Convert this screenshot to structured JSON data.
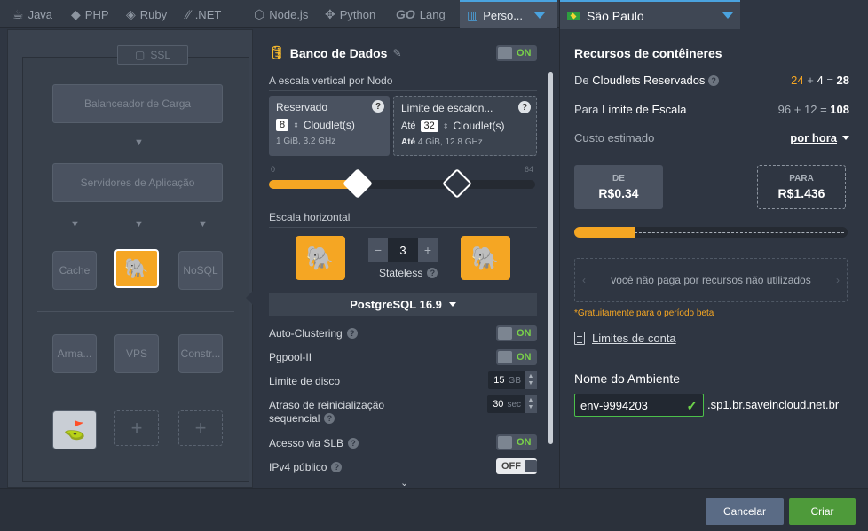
{
  "tabs": [
    {
      "label": "Java",
      "icon": "java-icon"
    },
    {
      "label": "PHP",
      "icon": "php-icon"
    },
    {
      "label": "Ruby",
      "icon": "ruby-icon"
    },
    {
      "label": ".NET",
      "icon": "dotnet-icon"
    },
    {
      "label": "Node.js",
      "icon": "nodejs-icon"
    },
    {
      "label": "Python",
      "icon": "python-icon"
    },
    {
      "label": "Lang",
      "icon": "go-icon",
      "prefix": "GO"
    },
    {
      "label": "Perso...",
      "icon": "custom-icon"
    }
  ],
  "topology": {
    "ssl_label": "SSL",
    "load_balancer": "Balanceador de Carga",
    "app_servers": "Servidores de Aplicação",
    "cache": "Cache",
    "nosql": "NoSQL",
    "storage": "Arma...",
    "vps": "VPS",
    "build": "Constr..."
  },
  "config": {
    "title": "Banco de Dados",
    "toggle_on": "ON",
    "toggle_off": "OFF",
    "vertical_scale_label": "A escala vertical por Nodo",
    "reserved": {
      "title": "Reservado",
      "count": "8",
      "unit": "Cloudlet(s)",
      "spec": "1 GiB, 3.2 GHz"
    },
    "limit": {
      "title": "Limite de escalon...",
      "prefix": "Até",
      "count": "32",
      "unit": "Cloudlet(s)",
      "spec": "4 GiB, 12.8 GHz"
    },
    "help_glyph": "?",
    "slider": {
      "min": "0",
      "max": "64",
      "reserved_value": 8,
      "limit_value": 32,
      "max_value": 64
    },
    "horizontal_scale_label": "Escala horizontal",
    "node_count": "3",
    "minus": "−",
    "plus": "+",
    "stateless_label": "Stateless",
    "version": "PostgreSQL 16.9",
    "options": {
      "auto_clustering": "Auto-Clustering",
      "pgpool": "Pgpool-II",
      "disk_limit": "Limite de disco",
      "disk_value": "15",
      "disk_unit": "GB",
      "restart_delay_1": "Atraso de reinicialização",
      "restart_delay_2": "sequencial",
      "restart_value": "30",
      "restart_unit": "sec",
      "slb_access": "Acesso via SLB",
      "public_ipv4": "IPv4 público"
    }
  },
  "summary": {
    "region": "São Paulo",
    "title": "Recursos de contêineres",
    "reserved_label_pre": "De",
    "reserved_label": "Cloudlets Reservados",
    "reserved_a": "24",
    "reserved_op": "+",
    "reserved_b": "4",
    "reserved_eq": "=",
    "reserved_total": "28",
    "limit_label_pre": "Para",
    "limit_label": "Limite de Escala",
    "limit_a": "96",
    "limit_op": "+",
    "limit_b": "12",
    "limit_eq": "=",
    "limit_total": "108",
    "estimate_label": "Custo estimado",
    "estimate_period": "por hora",
    "from_label": "DE",
    "from_value": "R$0.34",
    "to_label": "PARA",
    "to_value": "R$1.436",
    "cost_fraction": 0.22,
    "info_text": "você não paga por recursos não utilizados",
    "beta_note": "*Gratuitamente para o período beta",
    "account_limits": "Limites de conta",
    "env_label": "Nome do Ambiente",
    "env_value": "env-9994203",
    "env_domain": ".sp1.br.saveincloud.net.br"
  },
  "actions": {
    "cancel": "Cancelar",
    "create": "Criar"
  },
  "colors": {
    "accent": "#f5a623",
    "primary": "#4aa3df",
    "success": "#4e9a3a",
    "toggle_on": "#7ad14a"
  }
}
